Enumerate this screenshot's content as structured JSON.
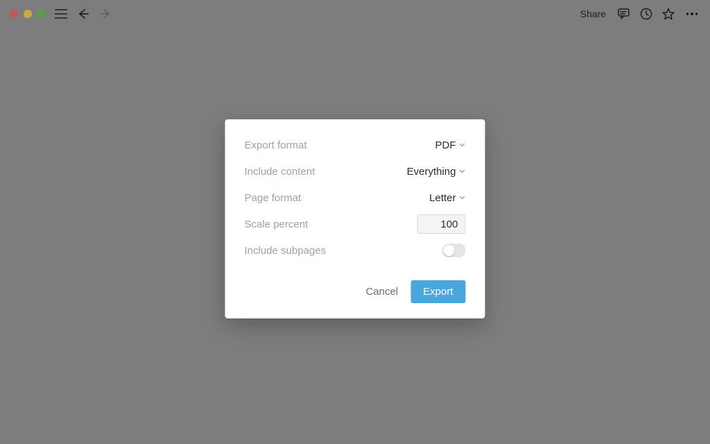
{
  "toolbar": {
    "share_label": "Share"
  },
  "modal": {
    "rows": {
      "export_format": {
        "label": "Export format",
        "value": "PDF"
      },
      "include_content": {
        "label": "Include content",
        "value": "Everything"
      },
      "page_format": {
        "label": "Page format",
        "value": "Letter"
      },
      "scale_percent": {
        "label": "Scale percent",
        "value": "100"
      },
      "include_subpages": {
        "label": "Include subpages",
        "enabled": false
      }
    },
    "actions": {
      "cancel": "Cancel",
      "export": "Export"
    }
  }
}
